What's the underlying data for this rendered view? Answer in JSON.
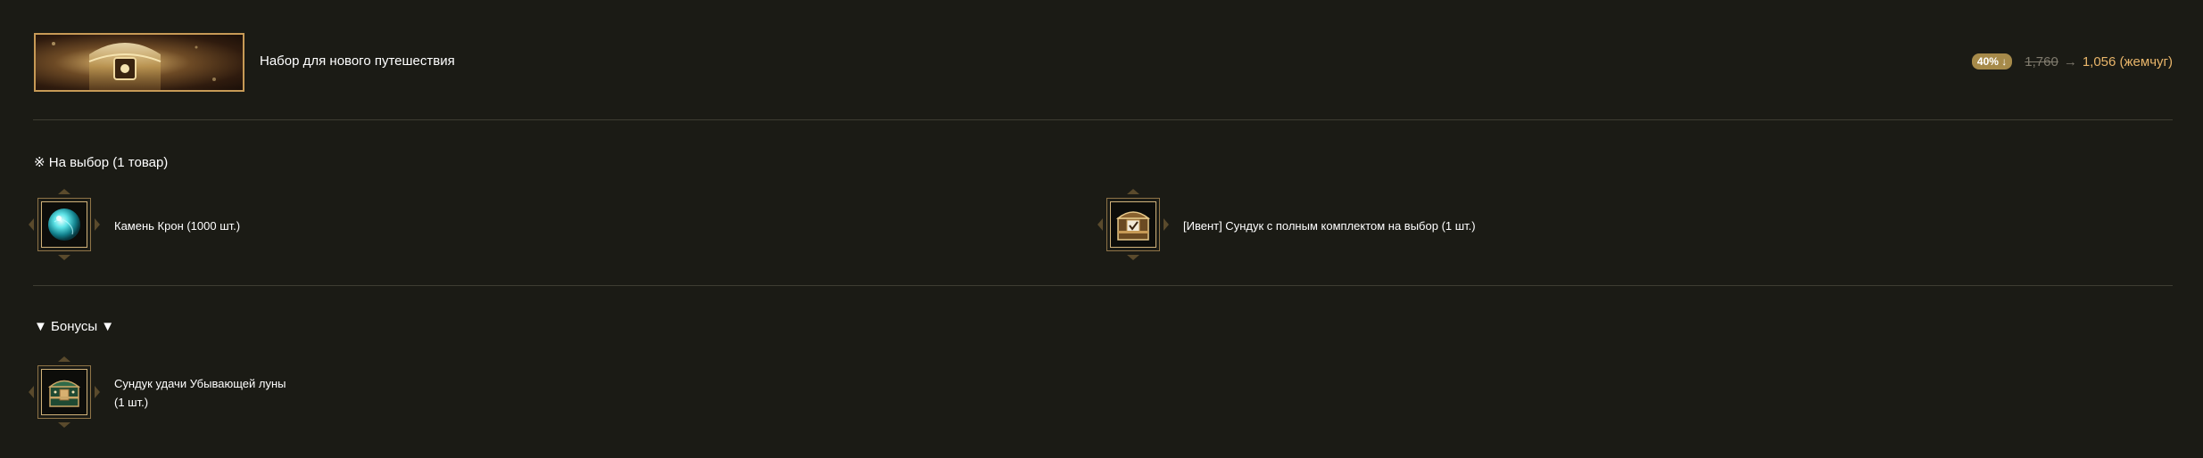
{
  "header": {
    "title": "Набор для нового путешествия",
    "discount_badge": "40% ↓",
    "old_price": "1,760",
    "arrow": "→",
    "new_price": "1,056 (жемчуг)"
  },
  "choice_section": {
    "title": "※ На выбор (1 товар)",
    "items": [
      {
        "label": "Камень Крон (1000 шт.)",
        "icon": "crystal-orb-icon"
      },
      {
        "label": "[Ивент] Сундук с полным комплектом на выбор (1 шт.)",
        "icon": "treasure-chest-icon"
      }
    ]
  },
  "bonus_section": {
    "title": "▼ Бонусы ▼",
    "items": [
      {
        "label_line1": "Сундук удачи Убывающей луны",
        "label_line2": "(1 шт.)",
        "icon": "green-chest-icon"
      }
    ]
  },
  "colors": {
    "background": "#1b1b15",
    "accent_gold": "#c79a56",
    "new_price": "#e8b56a",
    "badge": "#a68a4a",
    "divider": "#3e3d33"
  }
}
